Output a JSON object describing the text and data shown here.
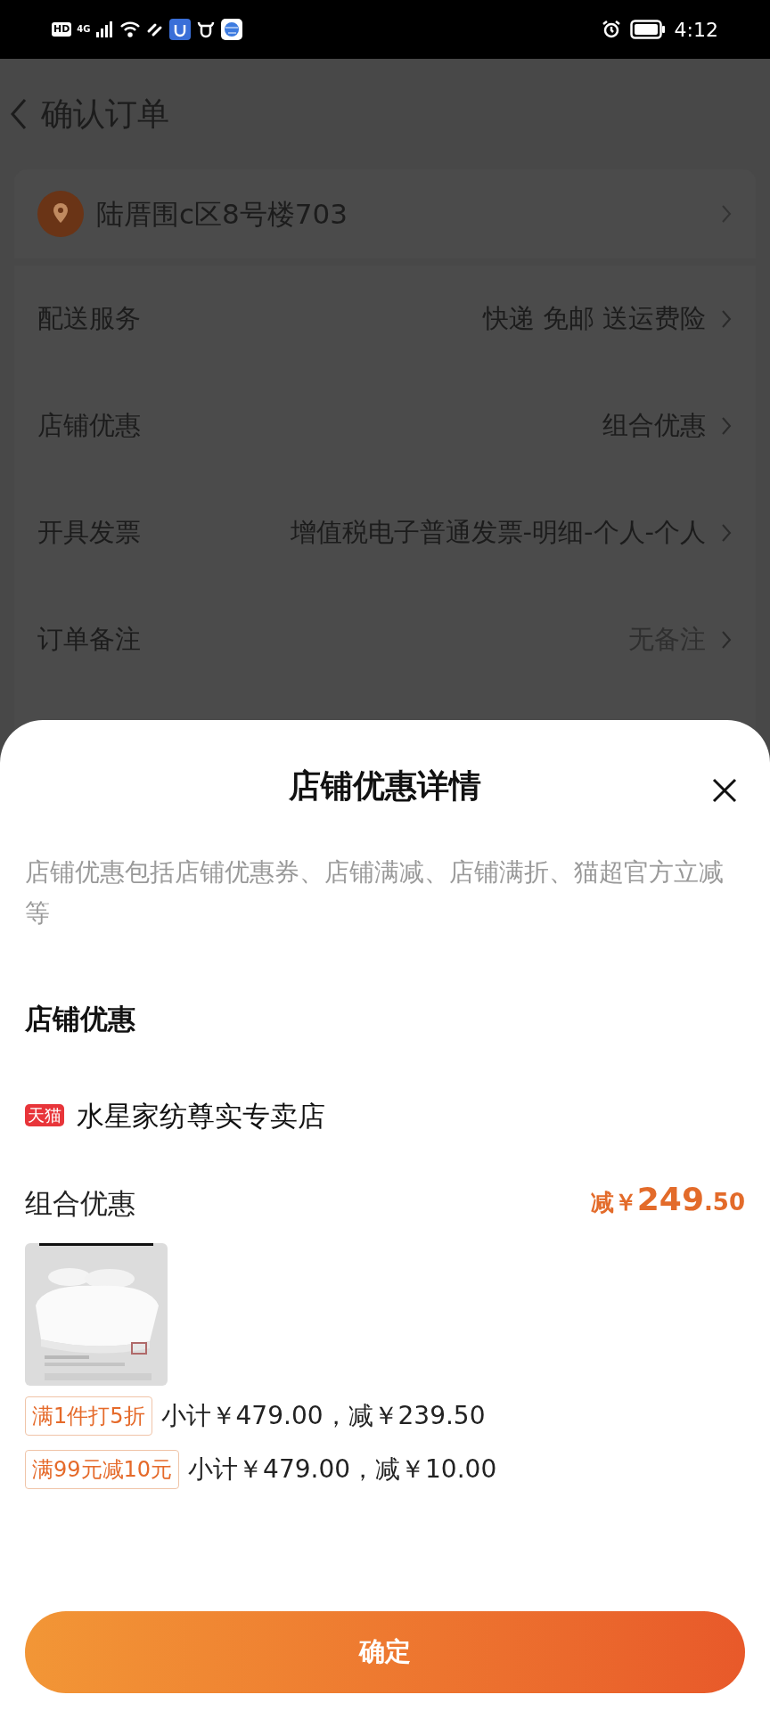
{
  "status_bar": {
    "network_badges": [
      "HD",
      "4G"
    ],
    "time": "4:12"
  },
  "header": {
    "title": "确认订单"
  },
  "address": {
    "text": "陆厝围c区8号楼703"
  },
  "order_rows": [
    {
      "label": "配送服务",
      "value": "快递 免邮 送运费险",
      "muted": false
    },
    {
      "label": "店铺优惠",
      "value": "组合优惠",
      "muted": false
    },
    {
      "label": "开具发票",
      "value": "增值税电子普通发票-明细-个人-个人",
      "muted": false
    },
    {
      "label": "订单备注",
      "value": "无备注",
      "muted": true
    }
  ],
  "sheet": {
    "title": "店铺优惠详情",
    "description": "店铺优惠包括店铺优惠券、店铺满减、店铺满折、猫超官方立减等",
    "section_title": "店铺优惠",
    "store": {
      "badge": "天猫",
      "name": "水星家纺尊实专卖店"
    },
    "discount": {
      "label": "组合优惠",
      "prefix": "减￥",
      "amount_integer": "249",
      "amount_decimal": ".50"
    },
    "rules": [
      {
        "tag": "满1件打5折",
        "detail": "小计￥479.00，减￥239.50"
      },
      {
        "tag": "满99元减10元",
        "detail": "小计￥479.00，减￥10.00"
      }
    ],
    "confirm_button": "确定"
  }
}
